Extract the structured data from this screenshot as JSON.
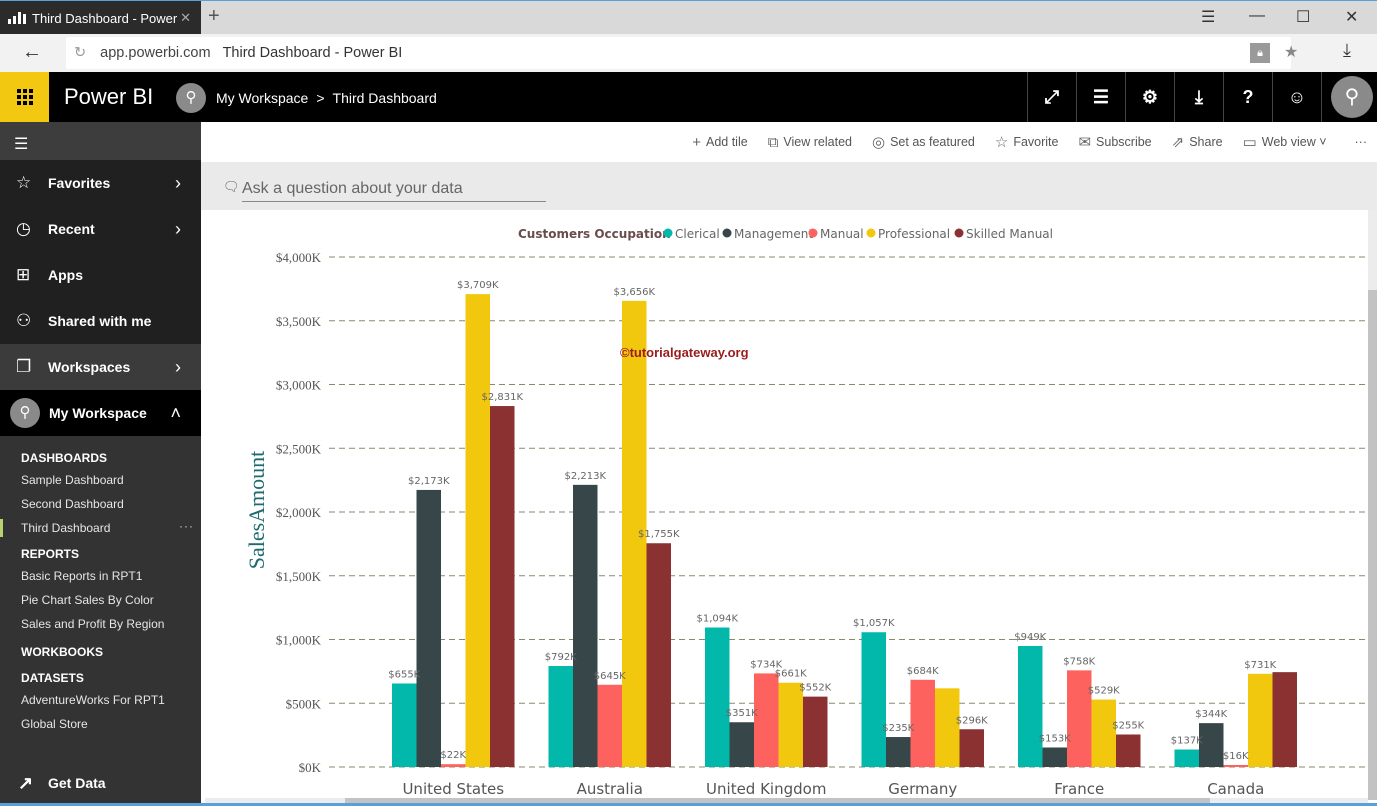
{
  "browser": {
    "tab_title": "Third Dashboard - Power",
    "url_host": "app.powerbi.com",
    "url_title": "Third Dashboard - Power BI",
    "new_tab": "+",
    "window_controls": {
      "menu": "☰",
      "minimize": "—",
      "maximize": "☐",
      "close": "✕"
    }
  },
  "header": {
    "brand": "Power BI",
    "breadcrumb": [
      "My Workspace",
      "Third Dashboard"
    ],
    "icons": [
      "expand-icon",
      "comment-icon",
      "gear-icon",
      "download-icon",
      "help-icon",
      "smiley-icon",
      "user-avatar"
    ]
  },
  "sidebar": {
    "nav": [
      {
        "label": "Favorites",
        "icon": "☆",
        "chevron": "›"
      },
      {
        "label": "Recent",
        "icon": "◷",
        "chevron": "›"
      },
      {
        "label": "Apps",
        "icon": "⊞",
        "chevron": ""
      },
      {
        "label": "Shared with me",
        "icon": "⚇",
        "chevron": ""
      },
      {
        "label": "Workspaces",
        "icon": "❐",
        "chevron": "›"
      }
    ],
    "my_workspace": {
      "label": "My Workspace",
      "chevron": "˄"
    },
    "sections": [
      {
        "title": "DASHBOARDS",
        "items": [
          "Sample Dashboard",
          "Second Dashboard",
          "Third Dashboard"
        ]
      },
      {
        "title": "REPORTS",
        "items": [
          "Basic Reports in RPT1",
          "Pie Chart Sales By Color",
          "Sales and Profit By Region"
        ]
      },
      {
        "title": "WORKBOOKS",
        "items": []
      },
      {
        "title": "DATASETS",
        "items": [
          "AdventureWorks For RPT1",
          "Global Store"
        ]
      }
    ],
    "active_item": "Third Dashboard",
    "more": "···",
    "get_data": "Get Data"
  },
  "toolbar": {
    "actions": [
      {
        "label": "Add tile",
        "icon": "+"
      },
      {
        "label": "View related",
        "icon": "⧉"
      },
      {
        "label": "Set as featured",
        "icon": "◎"
      },
      {
        "label": "Favorite",
        "icon": "☆"
      },
      {
        "label": "Subscribe",
        "icon": "✉"
      },
      {
        "label": "Share",
        "icon": "⇗"
      },
      {
        "label": "Web view ˅",
        "icon": "▭"
      }
    ],
    "more": "···"
  },
  "qna": {
    "placeholder": "Ask a question about your data"
  },
  "watermark": "©tutorialgateway.org",
  "chart_data": {
    "type": "bar",
    "title": "",
    "legend_title": "Customers Occupation",
    "legend_position": "top",
    "xlabel": "",
    "ylabel": "SalesAmount",
    "ylim": [
      0,
      4000
    ],
    "yticks": [
      "$0K",
      "$500K",
      "$1,000K",
      "$1,500K",
      "$2,000K",
      "$2,500K",
      "$3,000K",
      "$3,500K",
      "$4,000K"
    ],
    "grid": true,
    "categories": [
      "United States",
      "Australia",
      "United Kingdom",
      "Germany",
      "France",
      "Canada"
    ],
    "series": [
      {
        "name": "Clerical",
        "color": "#01b8aa",
        "values": [
          655,
          792,
          1094,
          1057,
          949,
          137
        ],
        "labels": [
          "$655K",
          "$792K",
          "$1,094K",
          "$1,057K",
          "$949K",
          "$137K"
        ]
      },
      {
        "name": "Management",
        "color": "#374649",
        "values": [
          2173,
          2213,
          351,
          235,
          153,
          344
        ],
        "labels": [
          "$2,173K",
          "$2,213K",
          "$351K",
          "$235K",
          "$153K",
          "$344K"
        ]
      },
      {
        "name": "Manual",
        "color": "#fd625e",
        "values": [
          22,
          645,
          734,
          684,
          758,
          16
        ],
        "labels": [
          "$22K",
          "$645K",
          "$734K",
          "$684K",
          "$758K",
          "$16K"
        ]
      },
      {
        "name": "Professional",
        "color": "#f2c80f",
        "values": [
          3709,
          3656,
          661,
          617,
          529,
          731
        ],
        "labels": [
          "$3,709K",
          "$3,656K",
          "$661K",
          "",
          "$529K",
          "$731K"
        ]
      },
      {
        "name": "Skilled Manual",
        "color": "#8b3132",
        "values": [
          2831,
          1755,
          552,
          296,
          255,
          744
        ],
        "labels": [
          "$2,831K",
          "$1,755K",
          "$552K",
          "$296K",
          "$255K",
          ""
        ]
      }
    ]
  }
}
